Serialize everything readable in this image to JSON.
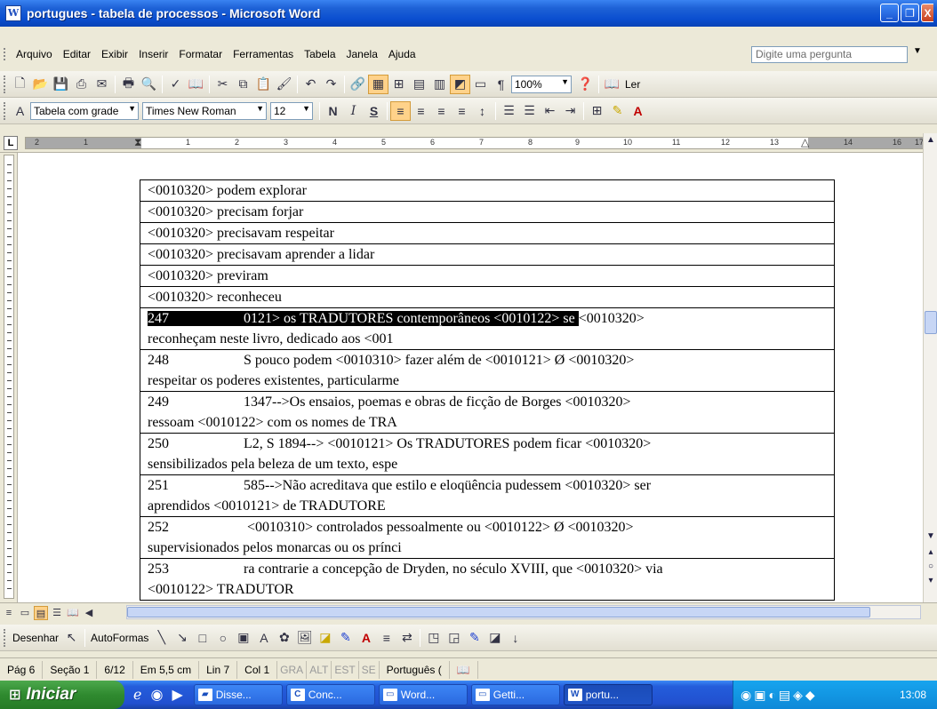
{
  "window": {
    "title": "portugues - tabela de processos - Microsoft Word",
    "minimize": "_",
    "maximize": "❐",
    "close": "X"
  },
  "menu": {
    "items": [
      "Arquivo",
      "Editar",
      "Exibir",
      "Inserir",
      "Formatar",
      "Ferramentas",
      "Tabela",
      "Janela",
      "Ajuda"
    ],
    "ask_placeholder": "Digite uma pergunta"
  },
  "toolbar_standard": {
    "zoom": "100%",
    "read_label": "Ler"
  },
  "toolbar_format": {
    "style": "Tabela com grade",
    "font": "Times New Roman",
    "size": "12",
    "bold": "N",
    "italic": "I",
    "underline": "S"
  },
  "ruler": {
    "labels": [
      "2",
      "1",
      "1",
      "2",
      "3",
      "4",
      "5",
      "6",
      "7",
      "8",
      "9",
      "10",
      "11",
      "12",
      "13",
      "14",
      "16",
      "17"
    ]
  },
  "document": {
    "rows": [
      {
        "num": "",
        "text": "<0010320> podem explorar",
        "cont": ""
      },
      {
        "num": "",
        "text": "<0010320> precisam forjar",
        "cont": ""
      },
      {
        "num": "",
        "text": "<0010320> precisavam respeitar",
        "cont": ""
      },
      {
        "num": "",
        "text": "<0010320> precisavam aprender a lidar",
        "cont": ""
      },
      {
        "num": "",
        "text": "<0010320> previram",
        "cont": ""
      },
      {
        "num": "",
        "text": "<0010320> reconheceu",
        "cont": ""
      },
      {
        "num": "247",
        "text": "0121> os TRADUTORES contemporâneos  <0010122> se ",
        "after": "<0010320>",
        "cont": "reconheçam neste livro,  dedicado aos  <001",
        "highlight": true
      },
      {
        "num": "248",
        "text": "S pouco podem  <0010310> fazer além de  <0010121> Ø <0010320>",
        "cont": "respeitar os poderes existentes, particularme"
      },
      {
        "num": "249",
        "text": "1347-->Os ensaios, poemas e obras de ficção de Borges  <0010320>",
        "cont": "ressoam  <0010122> com os nomes de TRA"
      },
      {
        "num": "250",
        "text": "L2, S 1894--> <0010121> Os TRADUTORES podem ficar  <0010320>",
        "cont": "sensibilizados pela beleza de um texto, espe"
      },
      {
        "num": "251",
        "text": "585-->Não acreditava que estilo e eloqüência pudessem  <0010320> ser",
        "cont": "aprendidos  <0010121> de TRADUTORE"
      },
      {
        "num": "252",
        "text": " <0010310> controlados pessoalmente ou  <0010122> Ø <0010320>",
        "cont": "supervisionados pelos monarcas ou os prínci"
      },
      {
        "num": "253",
        "text": "ra contrarie a concepção de Dryden, no século XVIII, que  <0010320> via",
        "cont": "<0010122>  TRADUTOR"
      }
    ]
  },
  "drawing": {
    "draw": "Desenhar",
    "autoshapes": "AutoFormas"
  },
  "status": {
    "page": "Pág 6",
    "section": "Seção 1",
    "pages": "6/12",
    "at": "Em 5,5 cm",
    "line": "Lin 7",
    "col": "Col 1",
    "rec": "GRA",
    "alt": "ALT",
    "ext": "EST",
    "ovr": "SE",
    "language": "Português ("
  },
  "taskbar": {
    "start": "Iniciar",
    "tasks": [
      {
        "label": "Disse...",
        "icon": "folder"
      },
      {
        "label": "Conc...",
        "icon": "C"
      },
      {
        "label": "Word...",
        "icon": "window"
      },
      {
        "label": "Getti...",
        "icon": "window"
      },
      {
        "label": "portu...",
        "icon": "word"
      }
    ],
    "clock": "13:08"
  }
}
